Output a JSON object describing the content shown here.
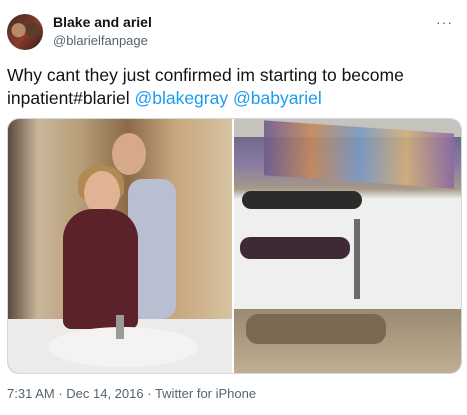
{
  "author": {
    "display_name": "Blake and ariel",
    "handle": "@blarielfanpage",
    "avatar_icon": "profile-avatar"
  },
  "menu_icon": "more-horizontal-icon",
  "tweet": {
    "text": "Why cant they just confirmed im starting to become inpatient#blariel ",
    "mentions": [
      "@blakegray",
      "@babyariel"
    ]
  },
  "media": {
    "count": 2
  },
  "footer": {
    "time": "7:31 AM",
    "separator": " · ",
    "date": "Dec 14, 2016",
    "source": "Twitter for iPhone"
  },
  "colors": {
    "link": "#1d9bf0",
    "secondary_text": "#536471",
    "primary_text": "#0f1419",
    "border": "#cfd9de"
  }
}
